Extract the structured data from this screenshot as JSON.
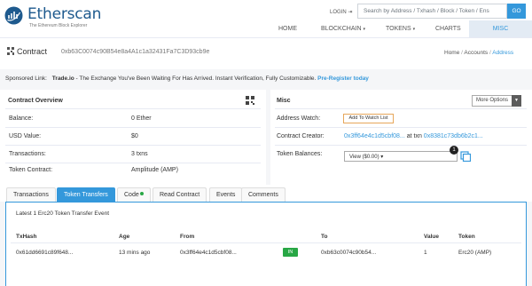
{
  "header": {
    "brand": "Etherscan",
    "tagline": "The Ethereum Block Explorer",
    "login_label": "LOGIN",
    "search_placeholder": "Search by Address / Txhash / Block / Token / Ens",
    "go_label": "GO",
    "nav": [
      {
        "label": "HOME"
      },
      {
        "label": "BLOCKCHAIN"
      },
      {
        "label": "TOKENS"
      },
      {
        "label": "CHARTS"
      },
      {
        "label": "MISC"
      }
    ],
    "accent_color": "#3498db"
  },
  "title": {
    "label": "Contract",
    "address": "0xb63C0074c90B54e8a4A1c1a32431Fa7C3D93cb9e",
    "breadcrumb": [
      "Home",
      "Accounts",
      "Address"
    ]
  },
  "sponsored": {
    "prefix": "Sponsored Link:",
    "name": "Trade.io",
    "text": "- The Exchange You've Been Waiting For Has Arrived. Instant Verification, Fully Customizable.",
    "cta": "Pre-Register today"
  },
  "overview": {
    "heading": "Contract Overview",
    "rows": [
      {
        "label": "Balance:",
        "value": "0 Ether"
      },
      {
        "label": "USD Value:",
        "value": "$0"
      },
      {
        "label": "Transactions:",
        "value": "3 txns"
      },
      {
        "label": "Token Contract:",
        "value": "Amplitude (AMP)"
      }
    ]
  },
  "misc": {
    "heading": "Misc",
    "more_options": "More Options",
    "address_watch_label": "Address Watch:",
    "watch_button": "Add To Watch List",
    "creator_label": "Contract Creator:",
    "creator_address": "0x3ff64e4c1d5cbf08...",
    "creator_at": "at txn",
    "creator_txn": "0x8381c73db6b2c1...",
    "balances_label": "Token Balances:",
    "view_select": "View ($0.00)",
    "badge_count": "1"
  },
  "tabs": [
    {
      "label": "Transactions"
    },
    {
      "label": "Token Transfers"
    },
    {
      "label": "Code"
    },
    {
      "label": "Read Contract"
    },
    {
      "label": "Events"
    },
    {
      "label": "Comments"
    }
  ],
  "transfers": {
    "summary": "Latest 1 Erc20 Token Transfer Event",
    "headers": [
      "TxHash",
      "Age",
      "From",
      "",
      "To",
      "Value",
      "Token"
    ],
    "rows": [
      {
        "txhash": "0x61dd6691c89f648...",
        "age": "13 mins ago",
        "from": "0x3ff64e4c1d5cbf08...",
        "direction": "IN",
        "to": "0xb63c0074c90b54...",
        "value": "1",
        "token": "Erc20 (AMP)"
      }
    ]
  }
}
